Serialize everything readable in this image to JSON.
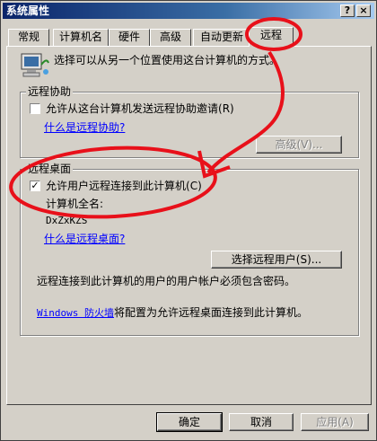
{
  "window": {
    "title": "系统属性",
    "help_btn": "?",
    "close_btn": "×"
  },
  "tabs": [
    {
      "label": "常规"
    },
    {
      "label": "计算机名"
    },
    {
      "label": "硬件"
    },
    {
      "label": "高级"
    },
    {
      "label": "自动更新"
    },
    {
      "label": "远程",
      "active": true
    }
  ],
  "intro": {
    "text": "选择可以从另一个位置使用这台计算机的方式。"
  },
  "remote_assist": {
    "title": "远程协助",
    "checkbox_label": "允许从这台计算机发送远程协助邀请",
    "checkbox_hotkey": "(R)",
    "checked": false,
    "link": "什么是远程协助?",
    "advanced_btn": "高级(V)..."
  },
  "remote_desktop": {
    "title": "远程桌面",
    "checkbox_label": "允许用户远程连接到此计算机",
    "checkbox_hotkey": "(C)",
    "checked": true,
    "fullname_label": "计算机全名:",
    "fullname_value": "DxZxKZS",
    "link": "什么是远程桌面?",
    "select_users_btn": "选择远程用户(S)...",
    "password_note": "远程连接到此计算机的用户的用户帐户必须包含密码。",
    "firewall_link": "Windows 防火墙",
    "firewall_text": "将配置为允许远程桌面连接到此计算机。"
  },
  "buttons": {
    "ok": "确定",
    "cancel": "取消",
    "apply": "应用(A)"
  },
  "colors": {
    "annotation": "#e8101a",
    "titlebar": "#0a246a",
    "link": "#0000ff"
  }
}
